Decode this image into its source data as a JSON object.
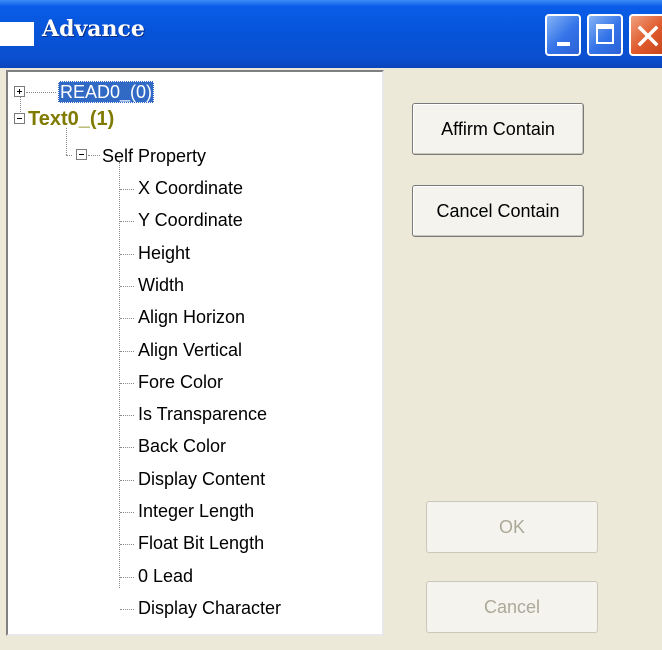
{
  "window": {
    "title": "Advance"
  },
  "titlebar": {
    "icons": [
      "minimize-icon",
      "maximize-icon",
      "close-icon"
    ]
  },
  "tree": {
    "nodes": [
      {
        "label": "READ0_(0)",
        "expander": "plus",
        "selected": true
      },
      {
        "label": "Text0_(1)",
        "expander": "minus"
      }
    ],
    "group": {
      "label": "Self Property",
      "expander": "minus"
    },
    "properties": [
      "X Coordinate",
      "Y Coordinate",
      "Height",
      "Width",
      "Align Horizon",
      "Align Vertical",
      "Fore Color",
      "Is Transparence",
      "Back Color",
      "Display Content",
      "Integer Length",
      "Float Bit Length",
      "0 Lead",
      "Display Character"
    ]
  },
  "buttons": {
    "affirm": "Affirm Contain",
    "cancel_contain": "Cancel Contain",
    "ok": "OK",
    "cancel": "Cancel"
  },
  "colors": {
    "selection": "#316ac5",
    "node_text0": "#7f7a00",
    "disabled_text": "#aca899",
    "titlebar": "#0653d8"
  }
}
